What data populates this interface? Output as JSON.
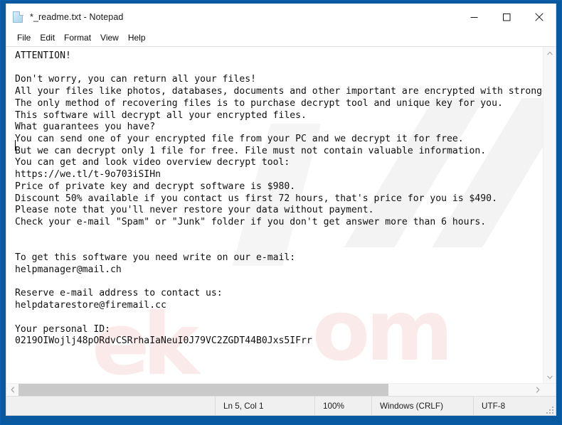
{
  "window": {
    "title": "*_readme.txt - Notepad",
    "icon": "notepad-document-icon",
    "accent_color": "#08599f",
    "controls": {
      "minimize": "minimize-icon",
      "maximize": "maximize-icon",
      "close": "close-icon"
    }
  },
  "menu": {
    "items": [
      {
        "label": "File"
      },
      {
        "label": "Edit"
      },
      {
        "label": "Format"
      },
      {
        "label": "View"
      },
      {
        "label": "Help"
      }
    ]
  },
  "document": {
    "text": "ATTENTION!\n\nDon't worry, you can return all your files!\nAll your files like photos, databases, documents and other important are encrypted with strongest encryption and unique key.\nThe only method of recovering files is to purchase decrypt tool and unique key for you.\nThis software will decrypt all your encrypted files.\nWhat guarantees you have?\nYou can send one of your encrypted file from your PC and we decrypt it for free.\nBut we can decrypt only 1 file for free. File must not contain valuable information.\nYou can get and look video overview decrypt tool:\nhttps://we.tl/t-9o703iSIHn\nPrice of private key and decrypt software is $980.\nDiscount 50% available if you contact us first 72 hours, that's price for you is $490.\nPlease note that you'll never restore your data without payment.\nCheck your e-mail \"Spam\" or \"Junk\" folder if you don't get answer more than 6 hours.\n\n\nTo get this software you need write on our e-mail:\nhelpmanager@mail.ch\n\nReserve e-mail address to contact us:\nhelpdatarestore@firemail.cc\n\nYour personal ID:\n0219OIWojlj48pORdvCSRrhaIaNeuI0J79VC2ZGDT44B0Jxs5IFrr",
    "ransom_details": {
      "video_overview_url": "https://we.tl/t-9o703iSIHn",
      "full_price": "$980",
      "discount_price": "$490",
      "discount_percent": "50%",
      "discount_window": "72 hours",
      "response_time": "6 hours",
      "primary_email": "helpmanager@mail.ch",
      "reserve_email": "helpdatarestore@firemail.cc",
      "personal_id": "0219OIWojlj48pORdvCSRrhaIaNeuI0J79VC2ZGDT44B0Jxs5IFrr",
      "free_decrypt_files": "1"
    }
  },
  "scrollbars": {
    "vertical": {
      "up_arrow": "chevron-up-icon",
      "down_arrow": "chevron-down-icon"
    },
    "horizontal": {
      "left_arrow": "chevron-left-icon",
      "right_arrow": "chevron-right-icon"
    }
  },
  "status_bar": {
    "cursor_position": "Ln 5, Col 1",
    "zoom": "100%",
    "line_ending": "Windows (CRLF)",
    "encoding": "UTF-8"
  },
  "watermarks": {
    "text_1": "om",
    "text_2": "ek"
  }
}
